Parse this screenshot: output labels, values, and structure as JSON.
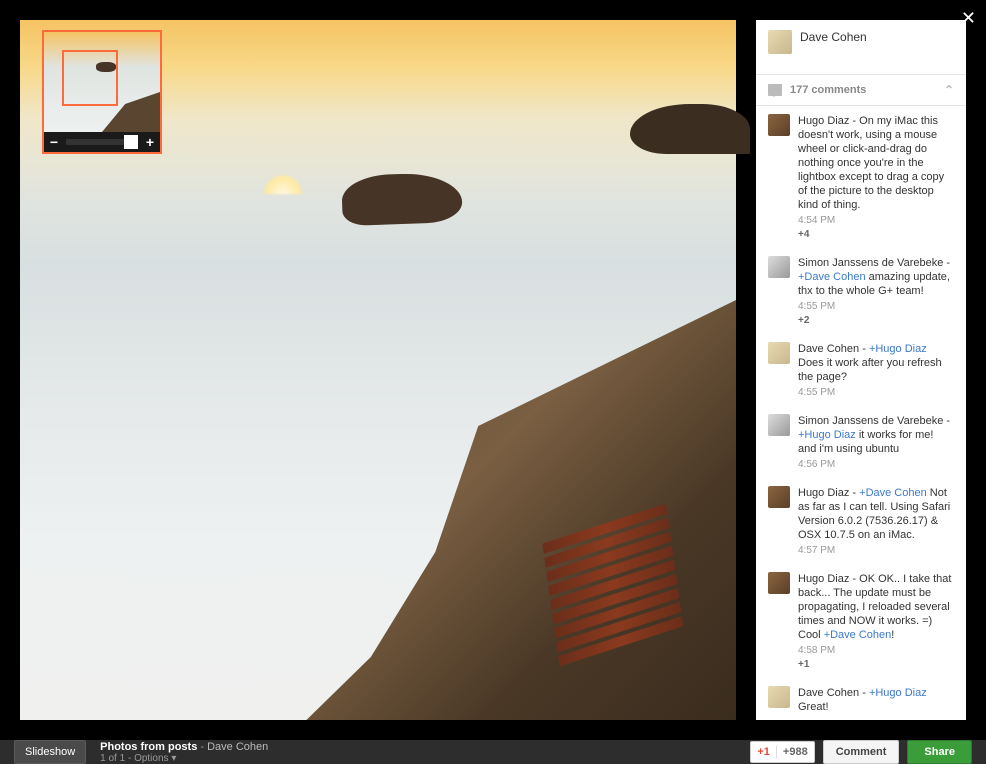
{
  "author": {
    "name": "Dave Cohen"
  },
  "comments_header": {
    "label": "177 comments"
  },
  "comments": [
    {
      "avatar": "hugo",
      "name": "Hugo Diaz",
      "sep": " - ",
      "mention": "",
      "text": "On my iMac this doesn't work, using a mouse wheel or click-and-drag do nothing once you're in the lightbox except to drag a copy of the picture to the desktop kind of thing.",
      "time": "4:54 PM",
      "plus": "+4"
    },
    {
      "avatar": "simon",
      "name": "Simon Janssens de Varebeke",
      "sep": " - ",
      "mention": "+Dave Cohen",
      "text": " amazing update, thx to the whole G+ team!",
      "time": "4:55 PM",
      "plus": "+2"
    },
    {
      "avatar": "dave",
      "name": "Dave Cohen",
      "sep": " - ",
      "mention": "+Hugo Diaz",
      "text": " Does it work after you refresh the page?",
      "time": "4:55 PM",
      "plus": ""
    },
    {
      "avatar": "simon",
      "name": "Simon Janssens de Varebeke",
      "sep": " - ",
      "mention": "+Hugo Diaz",
      "text": " it works for me! and i'm using ubuntu",
      "time": "4:56 PM",
      "plus": ""
    },
    {
      "avatar": "hugo",
      "name": "Hugo Diaz",
      "sep": " - ",
      "mention": "+Dave Cohen",
      "text": " Not as far as I can tell. Using Safari Version 6.0.2 (7536.26.17) & OSX 10.7.5 on an iMac.",
      "time": "4:57 PM",
      "plus": ""
    },
    {
      "avatar": "hugo",
      "name": "Hugo Diaz",
      "sep": " - ",
      "mention": "",
      "text": "OK OK.. I take that back... The update must be propagating, I reloaded several times and NOW it works. =)  Cool ",
      "mention2": "+Dave Cohen",
      "tail": "!",
      "time": "4:58 PM",
      "plus": "+1"
    },
    {
      "avatar": "dave",
      "name": "Dave Cohen",
      "sep": " - ",
      "mention": "+Hugo Diaz",
      "text": " Great!",
      "time": "",
      "plus": ""
    }
  ],
  "bottombar": {
    "slideshow": "Slideshow",
    "title": "Photos from posts",
    "author_sep": "  -  ",
    "author": "Dave Cohen",
    "counter": "1 of 1",
    "options_sep": "  -  ",
    "options": "Options",
    "caret": "▾",
    "plusone": "+1",
    "plusone_count": "+988",
    "comment": "Comment",
    "share": "Share"
  },
  "navigator": {
    "minus": "−",
    "plus": "+"
  }
}
